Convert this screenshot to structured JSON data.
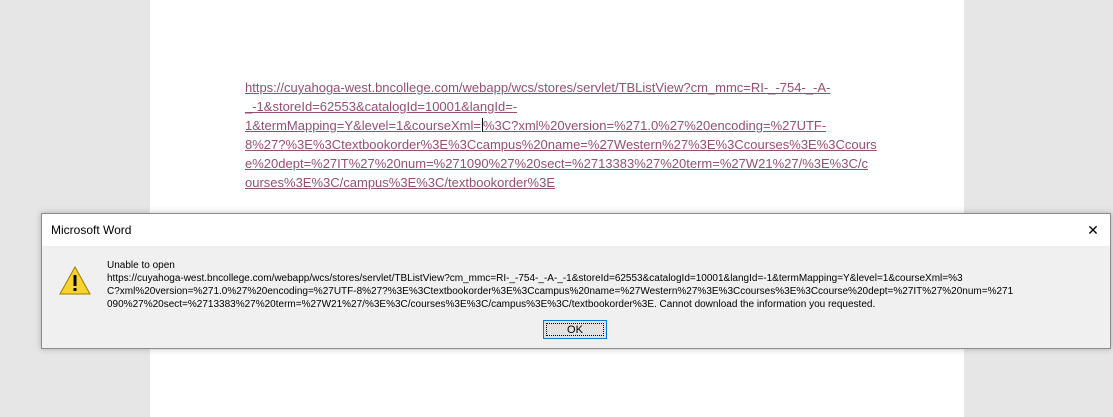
{
  "document": {
    "link_lines": [
      "https://cuyahoga-west.bncollege.com/webapp/wcs/stores/servlet/TBListView?cm_mmc=RI-_-754-_-A-",
      "_-1&storeId=62553&catalogId=10001&langId=-",
      "1&termMapping=Y&level=1&courseXml=",
      "%3C?xml%20version=%271.0%27%20encoding=%27UTF-",
      "8%27?%3E%3Ctextbookorder%3E%3Ccampus%20name=%27Western%27%3E%3Ccourses%3E%3Ccours",
      "e%20dept=%27IT%27%20num=%271090%27%20sect=%2713383%27%20term=%27W21%27/%3E%3C/c",
      "ourses%3E%3C/campus%3E%3C/textbookorder%3E"
    ]
  },
  "dialog": {
    "title": "Microsoft Word",
    "close_glyph": "✕",
    "message_lines": [
      "Unable to open",
      "https://cuyahoga-west.bncollege.com/webapp/wcs/stores/servlet/TBListView?cm_mmc=RI-_-754-_-A-_-1&storeId=62553&catalogId=10001&langId=-1&termMapping=Y&level=1&courseXml=%3",
      "C?xml%20version=%271.0%27%20encoding=%27UTF-8%27?%3E%3Ctextbookorder%3E%3Ccampus%20name=%27Western%27%3E%3Ccourses%3E%3Ccourse%20dept=%27IT%27%20num=%271",
      "090%27%20sect=%2713383%27%20term=%27W21%27/%3E%3C/courses%3E%3C/campus%3E%3C/textbookorder%3E. Cannot download the information you requested."
    ],
    "ok_label": "OK",
    "icon": "warning-icon",
    "warning_color": "#f8d32c"
  }
}
